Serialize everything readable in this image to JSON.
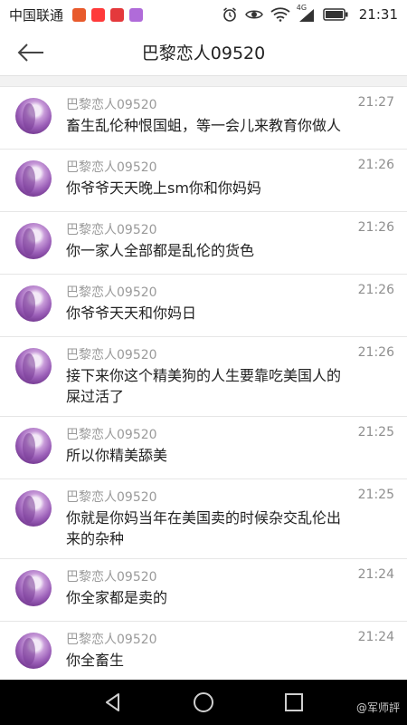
{
  "status_bar": {
    "carrier": "中国联通",
    "network": "4G",
    "time": "21:31",
    "app_icon_colors": [
      "#e85a2c",
      "#ff3a3a",
      "#e4393c",
      "#b06bd9"
    ]
  },
  "header": {
    "title": "巴黎恋人09520",
    "back_icon": "arrow-left-icon"
  },
  "messages": [
    {
      "sender": "巴黎恋人09520",
      "time": "21:27",
      "text": "畜生乱伦种恨国蛆，等一会儿来教育你做人"
    },
    {
      "sender": "巴黎恋人09520",
      "time": "21:26",
      "text": "你爷爷天天晚上sm你和你妈妈"
    },
    {
      "sender": "巴黎恋人09520",
      "time": "21:26",
      "text": "你一家人全部都是乱伦的货色"
    },
    {
      "sender": "巴黎恋人09520",
      "time": "21:26",
      "text": "你爷爷天天和你妈日"
    },
    {
      "sender": "巴黎恋人09520",
      "time": "21:26",
      "text": "接下来你这个精美狗的人生要靠吃美国人的屎过活了"
    },
    {
      "sender": "巴黎恋人09520",
      "time": "21:25",
      "text": "所以你精美舔美"
    },
    {
      "sender": "巴黎恋人09520",
      "time": "21:25",
      "text": "你就是你妈当年在美国卖的时候杂交乱伦出来的杂种"
    },
    {
      "sender": "巴黎恋人09520",
      "time": "21:24",
      "text": "你全家都是卖的"
    },
    {
      "sender": "巴黎恋人09520",
      "time": "21:24",
      "text": "你全畜生"
    }
  ],
  "nav_bar": {
    "back": "triangle-back-icon",
    "home": "circle-home-icon",
    "recent": "square-recent-icon"
  },
  "watermark": "@军师評"
}
